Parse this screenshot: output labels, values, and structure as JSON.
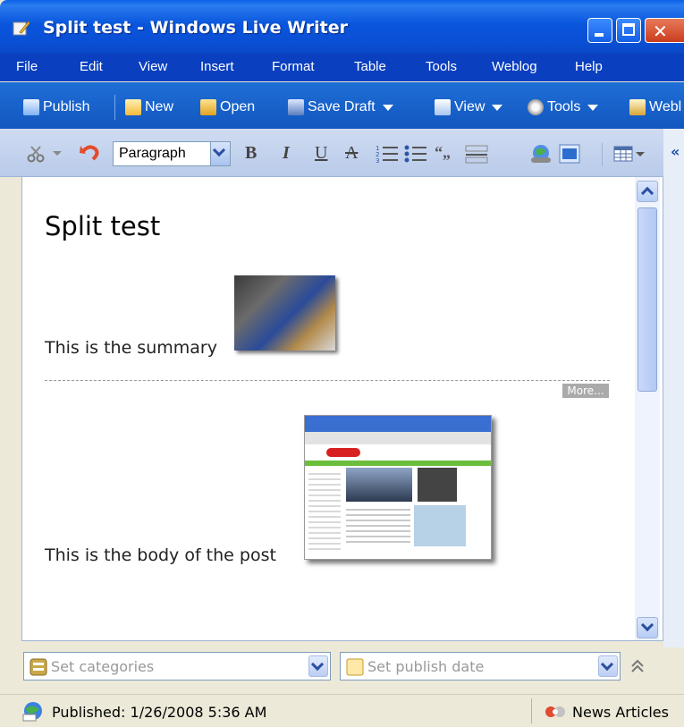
{
  "window": {
    "title": "Split test - Windows Live Writer",
    "colors": {
      "titlebar": "#0a55dc",
      "menubar": "#0a3fbf",
      "toolbar": "#1a64cc",
      "close_button": "#d2502e"
    }
  },
  "menu": {
    "items": [
      {
        "label": "File"
      },
      {
        "label": "Edit"
      },
      {
        "label": "View"
      },
      {
        "label": "Insert"
      },
      {
        "label": "Format"
      },
      {
        "label": "Table"
      },
      {
        "label": "Tools"
      },
      {
        "label": "Weblog"
      },
      {
        "label": "Help"
      }
    ]
  },
  "toolbar": {
    "publish": "Publish",
    "new": "New",
    "open": "Open",
    "save_draft": "Save Draft",
    "view": "View",
    "tools": "Tools",
    "weblog": "Webl"
  },
  "format": {
    "paragraph_style": "Paragraph",
    "bold": "B",
    "italic": "I",
    "underline": "U",
    "strike": "A",
    "quote": "“„"
  },
  "editor": {
    "post_title": "Split test",
    "summary_text": "This is the summary",
    "more_label": "More...",
    "body_text": "This is the body of the post"
  },
  "bottom": {
    "categories_placeholder": "Set categories",
    "publish_date_placeholder": "Set publish date"
  },
  "status": {
    "published": "Published: 1/26/2008 5:36 AM",
    "blog_name": "News Articles"
  }
}
